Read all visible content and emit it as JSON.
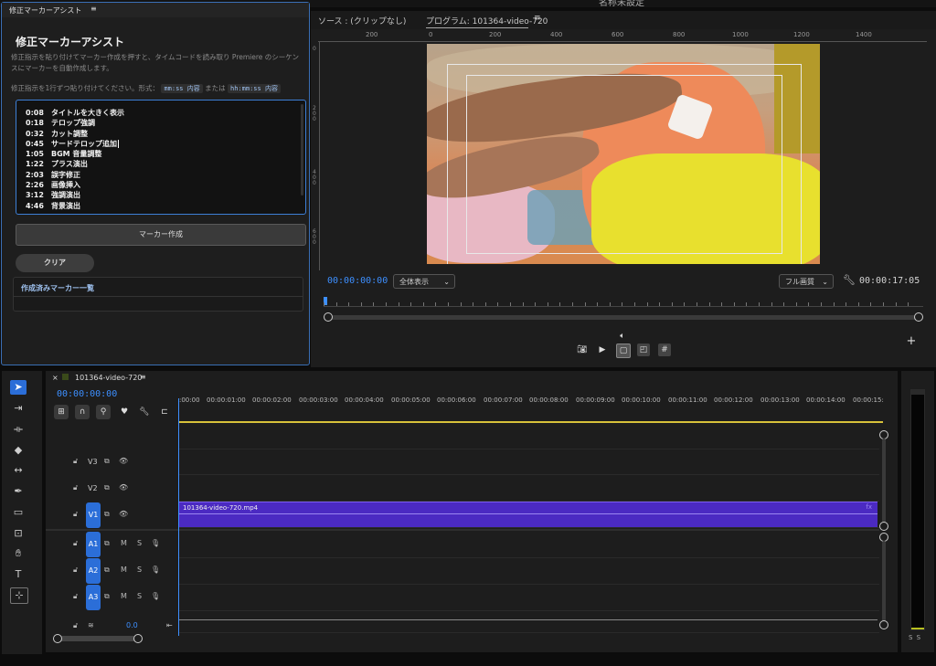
{
  "app": {
    "window_title": "名称未設定"
  },
  "program_monitor": {
    "tabs": [
      {
        "label": "ソース : (クリップなし)"
      },
      {
        "label": "プログラム: 101364-video-720"
      }
    ],
    "ruler_numbers": [
      "200",
      "0",
      "200",
      "400",
      "600",
      "800",
      "1000",
      "1200",
      "1400"
    ],
    "vruler_numbers": [
      "0",
      "2\n0\n0",
      "4\n0\n0",
      "6\n0\n0"
    ],
    "timecode_current": "00:00:00:00",
    "zoom_select": "全体表示",
    "quality_select": "フル画質",
    "timecode_duration": "00:00:17:05"
  },
  "marker_panel": {
    "header": "修正マーカーアシスト",
    "title": "修正マーカーアシスト",
    "description": "修正指示を貼り付けてマーカー作成を押すと、タイムコードを読み取り Premiere のシーケンスにマーカーを自動作成します。",
    "format_prefix": "修正指示を1行ずつ貼り付けてください。形式：",
    "format_code1": "mm:ss 内容",
    "format_mid": "または",
    "format_code2": "hh:mm:ss 内容",
    "entries": [
      {
        "time": "0:08",
        "text": "タイトルを大きく表示"
      },
      {
        "time": "0:18",
        "text": "テロップ強調"
      },
      {
        "time": "0:32",
        "text": "カット調整"
      },
      {
        "time": "0:45",
        "text": "サードテロップ追加"
      },
      {
        "time": "1:05",
        "text": "BGM 音量調整"
      },
      {
        "time": "1:22",
        "text": "プラス演出"
      },
      {
        "time": "2:03",
        "text": "誤字修正"
      },
      {
        "time": "2:26",
        "text": "画像挿入"
      },
      {
        "time": "3:12",
        "text": "強調演出"
      },
      {
        "time": "4:46",
        "text": "背景演出"
      }
    ],
    "create_button": "マーカー作成",
    "clear_button": "クリア",
    "created_list_title": "作成済みマーカー一覧"
  },
  "timeline": {
    "sequence_name": "101364-video-720",
    "timecode": "00:00:00:00",
    "ruler_labels": [
      ":00:00",
      "00:00:01:00",
      "00:00:02:00",
      "00:00:03:00",
      "00:00:04:00",
      "00:00:05:00",
      "00:00:06:00",
      "00:00:07:00",
      "00:00:08:00",
      "00:00:09:00",
      "00:00:10:00",
      "00:00:11:00",
      "00:00:12:00",
      "00:00:13:00",
      "00:00:14:00",
      "00:00:15:"
    ],
    "video_tracks": [
      {
        "label": "V3",
        "badge": false
      },
      {
        "label": "V2",
        "badge": false
      },
      {
        "label": "V1",
        "badge": true
      }
    ],
    "audio_tracks": [
      {
        "label": "A1",
        "m": "M",
        "s": "S"
      },
      {
        "label": "A2",
        "m": "M",
        "s": "S"
      },
      {
        "label": "A3",
        "m": "M",
        "s": "S"
      }
    ],
    "master_value": "0.0",
    "clip_name": "101364-video-720.mp4",
    "clip_fx": "fx"
  },
  "audio_meter": {
    "label": "S S"
  },
  "colors": {
    "accent_blue": "#3d8fff",
    "clip_purple": "#4b2ac2",
    "track_badge": "#2b6ed8",
    "work_area_yellow": "#d7c13a"
  }
}
